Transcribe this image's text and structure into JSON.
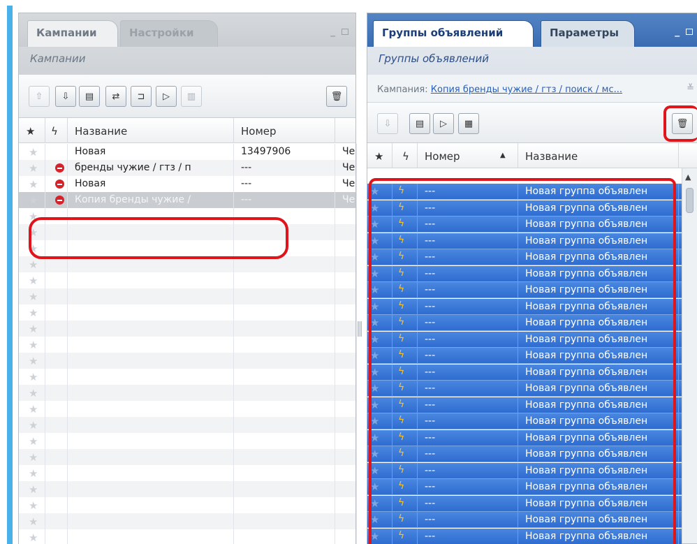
{
  "colors": {
    "accent_blue": "#3a6cb3",
    "selected_row": "#2e6cd0",
    "highlight_red": "#e0141b",
    "stop_red": "#d6232b"
  },
  "left_panel": {
    "tabs": [
      "Кампании",
      "Настройки"
    ],
    "subtitle": "Кампании",
    "toolbar_icons": [
      "upload-icon",
      "download-icon",
      "document-icon",
      "transfer-icon",
      "import-icon",
      "export-icon",
      "stats-icon",
      "trash-icon"
    ],
    "columns": [
      "Название",
      "Номер"
    ],
    "rows": [
      {
        "name": "Новая",
        "number": "13497906",
        "status": "",
        "extra": "Че"
      },
      {
        "name": "бренды чужие / гтз / п",
        "number": "---",
        "status": "stopped",
        "extra": "Че"
      },
      {
        "name": "Новая",
        "number": "---",
        "status": "stopped",
        "extra": "Че"
      },
      {
        "name": "Копия бренды чужие /",
        "number": "---",
        "status": "stopped",
        "extra": "Че"
      }
    ]
  },
  "right_panel": {
    "tabs": [
      "Группы объявлений",
      "Параметры"
    ],
    "subtitle": "Группы объявлений",
    "filter_label": "Кампания:",
    "filter_value": "Копия бренды чужие / гтз / поиск / мс...",
    "toolbar_icons": [
      "download-icon",
      "document-icon",
      "export-icon",
      "table-icon",
      "trash-icon"
    ],
    "columns": [
      "Номер",
      "Название"
    ],
    "sort_indicator": "▲",
    "row_number": "---",
    "row_name": "Новая группа объявлен"
  }
}
